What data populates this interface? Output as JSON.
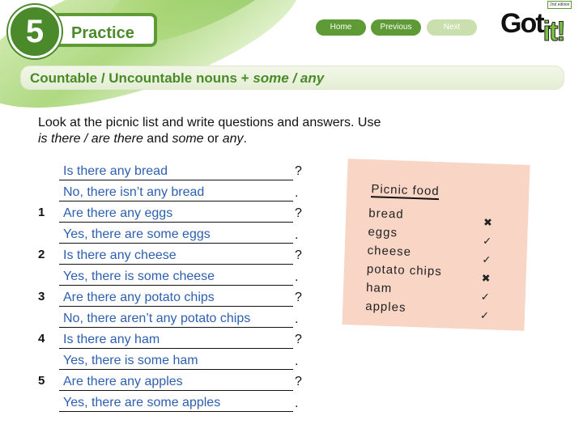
{
  "header": {
    "unit": "5",
    "section": "Practice",
    "nav": {
      "home": "Home",
      "previous": "Previous",
      "next": "Next"
    },
    "logo": {
      "text1": "Got",
      "text2": "it!",
      "edition": "2nd edition"
    }
  },
  "topic": {
    "main": "Countable / Uncountable nouns + ",
    "em1": "some",
    "sep": " / ",
    "em2": "any"
  },
  "instructions": {
    "line1": "Look at the picnic list and write questions and answers. Use",
    "em1": "is there / are there",
    "mid": " and ",
    "em2": "some",
    "or": " or ",
    "em3": "any",
    "end": "."
  },
  "exercises": [
    {
      "num": "",
      "q": "Is there any bread",
      "a": "No, there isn’t any bread"
    },
    {
      "num": "1",
      "q": "Are there any eggs",
      "a": "Yes, there are some eggs"
    },
    {
      "num": "2",
      "q": "Is there any cheese",
      "a": "Yes, there is some cheese"
    },
    {
      "num": "3",
      "q": "Are there any potato chips",
      "a": "No, there aren’t any potato chips"
    },
    {
      "num": "4",
      "q": "Is there any ham",
      "a": "Yes, there is some ham"
    },
    {
      "num": "5",
      "q": "Are there any apples",
      "a": "Yes, there are some apples"
    }
  ],
  "punct": {
    "q": "?",
    "a": "."
  },
  "picnic": {
    "title": "Picnic food",
    "items": [
      {
        "food": "bread",
        "mark": "✖"
      },
      {
        "food": "eggs",
        "mark": "✓"
      },
      {
        "food": "cheese",
        "mark": "✓"
      },
      {
        "food": "potato chips",
        "mark": "✖"
      },
      {
        "food": "ham",
        "mark": "✓"
      },
      {
        "food": "apples",
        "mark": "✓"
      }
    ]
  }
}
